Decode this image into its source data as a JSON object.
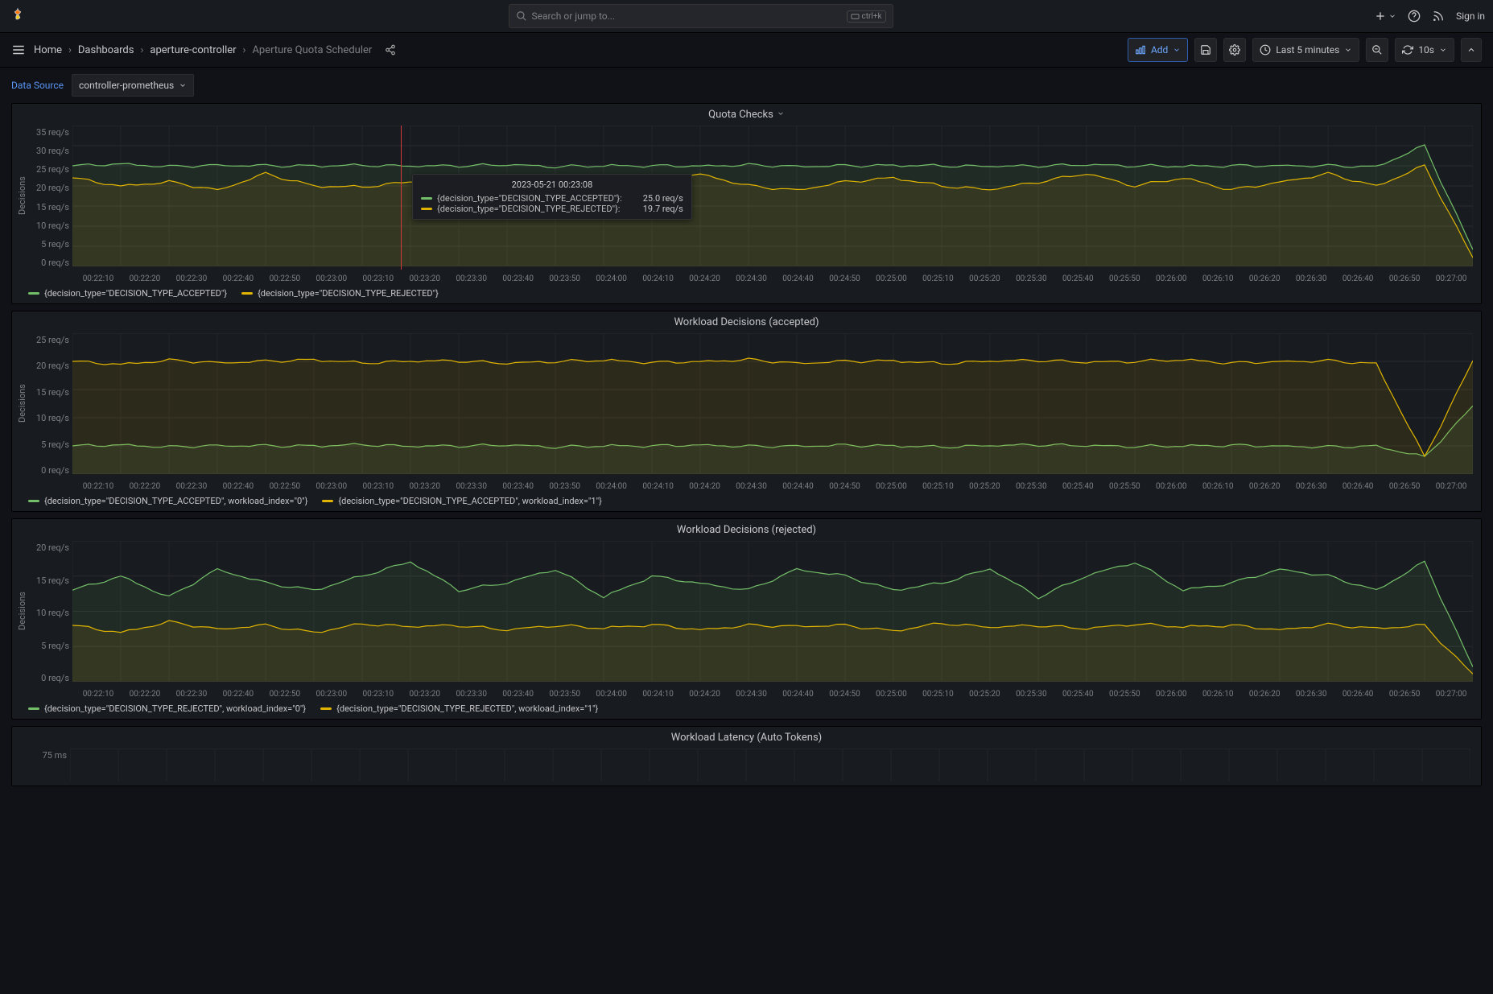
{
  "topbar": {
    "search_placeholder": "Search or jump to...",
    "search_shortcut": "ctrl+k",
    "signin": "Sign in"
  },
  "breadcrumbs": {
    "home": "Home",
    "dashboards": "Dashboards",
    "folder": "aperture-controller",
    "current": "Aperture Quota Scheduler"
  },
  "toolbar": {
    "add_label": "Add",
    "time_label": "Last 5 minutes",
    "refresh_interval": "10s"
  },
  "variables": {
    "label": "Data Source",
    "value": "controller-prometheus"
  },
  "panels": [
    {
      "title": "Quota Checks",
      "ylabel": "Decisions",
      "has_dropdown": true
    },
    {
      "title": "Workload Decisions (accepted)",
      "ylabel": "Decisions"
    },
    {
      "title": "Workload Decisions (rejected)",
      "ylabel": "Decisions"
    },
    {
      "title": "Workload Latency (Auto Tokens)",
      "ylabel": ""
    }
  ],
  "x_ticks": [
    "00:22:10",
    "00:22:20",
    "00:22:30",
    "00:22:40",
    "00:22:50",
    "00:23:00",
    "00:23:10",
    "00:23:20",
    "00:23:30",
    "00:23:40",
    "00:23:50",
    "00:24:00",
    "00:24:10",
    "00:24:20",
    "00:24:30",
    "00:24:40",
    "00:24:50",
    "00:25:00",
    "00:25:10",
    "00:25:20",
    "00:25:30",
    "00:25:40",
    "00:25:50",
    "00:26:00",
    "00:26:10",
    "00:26:20",
    "00:26:30",
    "00:26:40",
    "00:26:50",
    "00:27:00"
  ],
  "tooltip": {
    "time": "2023-05-21 00:23:08",
    "rows": [
      {
        "color": "#73bf69",
        "label": "{decision_type=\"DECISION_TYPE_ACCEPTED\"}:",
        "value": "25.0 req/s"
      },
      {
        "color": "#e0b400",
        "label": "{decision_type=\"DECISION_TYPE_REJECTED\"}:",
        "value": "19.7 req/s"
      }
    ]
  },
  "chart_data": [
    {
      "id": "quota_checks",
      "type": "line",
      "title": "Quota Checks",
      "ylabel": "Decisions",
      "yunit": "req/s",
      "ylim": [
        0,
        35
      ],
      "y_ticks": [
        "35 req/s",
        "30 req/s",
        "25 req/s",
        "20 req/s",
        "15 req/s",
        "10 req/s",
        "5 req/s",
        "0 req/s"
      ],
      "x": [
        "00:22:10",
        "00:22:20",
        "00:22:30",
        "00:22:40",
        "00:22:50",
        "00:23:00",
        "00:23:10",
        "00:23:20",
        "00:23:30",
        "00:23:40",
        "00:23:50",
        "00:24:00",
        "00:24:10",
        "00:24:20",
        "00:24:30",
        "00:24:40",
        "00:24:50",
        "00:25:00",
        "00:25:10",
        "00:25:20",
        "00:25:30",
        "00:25:40",
        "00:25:50",
        "00:26:00",
        "00:26:10",
        "00:26:20",
        "00:26:30",
        "00:26:40",
        "00:26:50",
        "00:27:00"
      ],
      "series": [
        {
          "name": "{decision_type=\"DECISION_TYPE_ACCEPTED\"}",
          "color": "#73bf69",
          "values": [
            25,
            25.5,
            24.8,
            25.2,
            25,
            25,
            25.1,
            24.9,
            25,
            25.2,
            24.8,
            25,
            25,
            25,
            25.2,
            24.9,
            25,
            25.1,
            25,
            24.8,
            25,
            25.2,
            25,
            24.9,
            25,
            25.1,
            25,
            24.8,
            30,
            4
          ]
        },
        {
          "name": "{decision_type=\"DECISION_TYPE_REJECTED\"}",
          "color": "#e0b400",
          "values": [
            22,
            20,
            21,
            19,
            23,
            20,
            19.7,
            21,
            20,
            22,
            19,
            20,
            21,
            23,
            20,
            19,
            21,
            22,
            20,
            19,
            21,
            23,
            20,
            22,
            19,
            21,
            23,
            20,
            25,
            2
          ]
        }
      ]
    },
    {
      "id": "wl_accepted",
      "type": "line",
      "title": "Workload Decisions (accepted)",
      "ylabel": "Decisions",
      "yunit": "req/s",
      "ylim": [
        0,
        25
      ],
      "y_ticks": [
        "25 req/s",
        "20 req/s",
        "15 req/s",
        "10 req/s",
        "5 req/s",
        "0 req/s"
      ],
      "x": [
        "00:22:10",
        "00:22:20",
        "00:22:30",
        "00:22:40",
        "00:22:50",
        "00:23:00",
        "00:23:10",
        "00:23:20",
        "00:23:30",
        "00:23:40",
        "00:23:50",
        "00:24:00",
        "00:24:10",
        "00:24:20",
        "00:24:30",
        "00:24:40",
        "00:24:50",
        "00:25:00",
        "00:25:10",
        "00:25:20",
        "00:25:30",
        "00:25:40",
        "00:25:50",
        "00:26:00",
        "00:26:10",
        "00:26:20",
        "00:26:30",
        "00:26:40",
        "00:26:50",
        "00:27:00"
      ],
      "series": [
        {
          "name": "{decision_type=\"DECISION_TYPE_ACCEPTED\", workload_index=\"0\"}",
          "color": "#73bf69",
          "values": [
            5,
            5.2,
            4.8,
            5.1,
            5,
            5,
            5.2,
            4.9,
            5,
            5.1,
            4.8,
            5,
            5,
            5.2,
            4.9,
            5,
            5.1,
            5,
            4.8,
            5,
            5.2,
            5,
            4.9,
            5,
            5.1,
            5,
            4.8,
            5,
            3,
            12
          ]
        },
        {
          "name": "{decision_type=\"DECISION_TYPE_ACCEPTED\", workload_index=\"1\"}",
          "color": "#e0b400",
          "values": [
            20,
            19.5,
            20.2,
            19.8,
            20,
            20.3,
            19.7,
            20,
            20.1,
            19.6,
            20,
            20.2,
            19.8,
            20,
            20.3,
            19.7,
            20,
            20.1,
            19.6,
            20,
            20.2,
            19.8,
            20,
            20.3,
            19.7,
            20,
            20.1,
            19.6,
            3,
            20
          ]
        }
      ]
    },
    {
      "id": "wl_rejected",
      "type": "line",
      "title": "Workload Decisions (rejected)",
      "ylabel": "Decisions",
      "yunit": "req/s",
      "ylim": [
        0,
        20
      ],
      "y_ticks": [
        "20 req/s",
        "15 req/s",
        "10 req/s",
        "5 req/s",
        "0 req/s"
      ],
      "x": [
        "00:22:10",
        "00:22:20",
        "00:22:30",
        "00:22:40",
        "00:22:50",
        "00:23:00",
        "00:23:10",
        "00:23:20",
        "00:23:30",
        "00:23:40",
        "00:23:50",
        "00:24:00",
        "00:24:10",
        "00:24:20",
        "00:24:30",
        "00:24:40",
        "00:24:50",
        "00:25:00",
        "00:25:10",
        "00:25:20",
        "00:25:30",
        "00:25:40",
        "00:25:50",
        "00:26:00",
        "00:26:10",
        "00:26:20",
        "00:26:30",
        "00:26:40",
        "00:26:50",
        "00:27:00"
      ],
      "series": [
        {
          "name": "{decision_type=\"DECISION_TYPE_REJECTED\", workload_index=\"0\"}",
          "color": "#73bf69",
          "values": [
            13,
            15,
            12,
            16,
            14,
            13,
            15,
            17,
            13,
            14,
            16,
            12,
            15,
            14,
            13,
            16,
            15,
            13,
            14,
            16,
            12,
            15,
            17,
            13,
            14,
            16,
            15,
            13,
            17,
            2
          ]
        },
        {
          "name": "{decision_type=\"DECISION_TYPE_REJECTED\", workload_index=\"1\"}",
          "color": "#e0b400",
          "values": [
            8,
            7,
            8.5,
            7.5,
            8,
            7,
            8.2,
            7.8,
            8,
            7.3,
            8,
            7.6,
            8.1,
            7.4,
            8,
            7.9,
            8,
            7.2,
            8.3,
            7.7,
            8,
            7.5,
            8.2,
            7.8,
            8,
            7.4,
            8.1,
            7.6,
            8,
            1
          ]
        }
      ]
    },
    {
      "id": "wl_latency",
      "type": "line",
      "title": "Workload Latency (Auto Tokens)",
      "ylabel": "",
      "yunit": "ms",
      "ylim": [
        0,
        100
      ],
      "y_ticks": [
        "75 ms"
      ],
      "x": [],
      "series": []
    }
  ]
}
